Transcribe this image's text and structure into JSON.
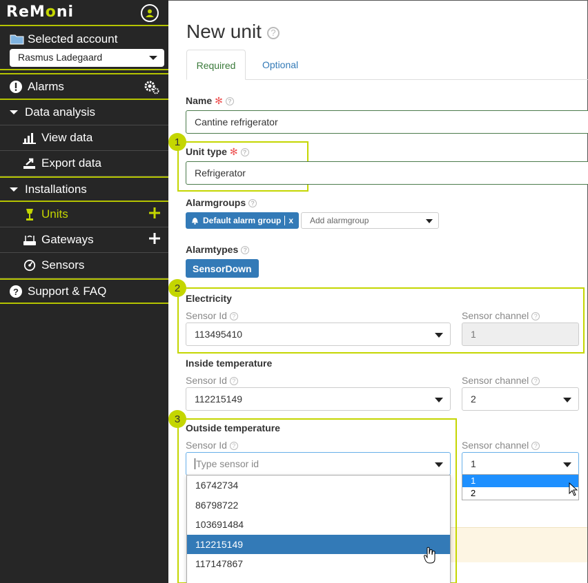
{
  "brand": {
    "logo_main": "ReM",
    "logo_accent": "o",
    "logo_end": "ni",
    "accent": "#c4d600",
    "sidebar_bg": "#262626"
  },
  "account": {
    "header": "Selected account",
    "selected": "Rasmus Ladegaard"
  },
  "nav": {
    "alarms": "Alarms",
    "data_analysis": "Data analysis",
    "view_data": "View data",
    "export_data": "Export data",
    "installations": "Installations",
    "units": "Units",
    "gateways": "Gateways",
    "sensors": "Sensors",
    "support": "Support & FAQ"
  },
  "page": {
    "title": "New unit"
  },
  "tabs": {
    "required": "Required",
    "optional": "Optional"
  },
  "form": {
    "name_label": "Name",
    "name_value": "Cantine refrigerator",
    "unit_type_label": "Unit type",
    "unit_type_value": "Refrigerator",
    "alarmgroups_label": "Alarmgroups",
    "alarmgroup_tag": "Default alarm group",
    "alarmgroup_tag_remove": "x",
    "add_alarmgroup_placeholder": "Add alarmgroup",
    "alarmtypes_label": "Alarmtypes",
    "alarmtype_button": "SensorDown",
    "electricity": {
      "title": "Electricity",
      "sensor_label": "Sensor Id",
      "sensor_value": "113495410",
      "channel_label": "Sensor channel",
      "channel_value": "1"
    },
    "inside": {
      "title": "Inside temperature",
      "sensor_label": "Sensor Id",
      "sensor_value": "112215149",
      "channel_label": "Sensor channel",
      "channel_value": "2"
    },
    "outside": {
      "title": "Outside temperature",
      "sensor_label": "Sensor Id",
      "sensor_placeholder": "Type sensor id",
      "channel_label": "Sensor channel",
      "channel_value": "1",
      "sensor_options": [
        "16742734",
        "86798722",
        "103691484",
        "112215149",
        "117147867"
      ],
      "channel_options": [
        "1",
        "2"
      ]
    }
  },
  "badges": [
    "1",
    "2",
    "3"
  ],
  "colors": {
    "primary": "#337ab7",
    "highlight": "#c4d600",
    "required": "#e55"
  }
}
